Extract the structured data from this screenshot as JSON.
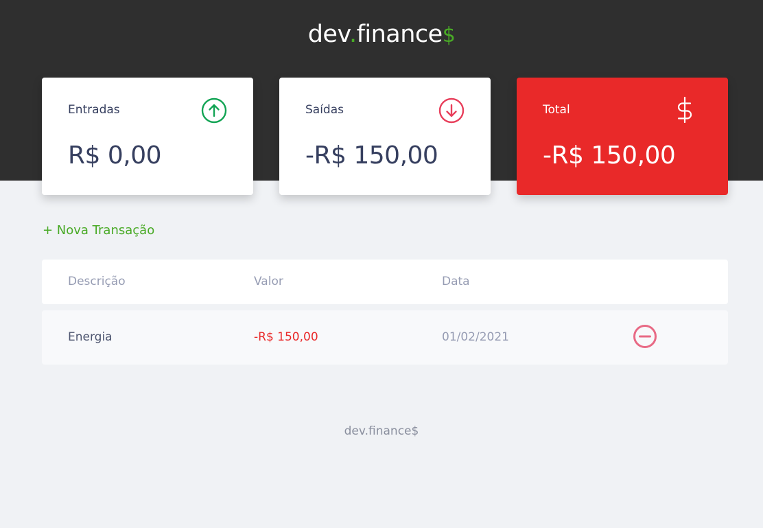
{
  "header": {
    "logo": {
      "main": "dev",
      "dot": ".",
      "rest": "finance",
      "dollar": "$"
    }
  },
  "summary": {
    "income": {
      "label": "Entradas",
      "value": "R$ 0,00",
      "icon": "arrow-up-circle-icon"
    },
    "expense": {
      "label": "Saídas",
      "value": "-R$ 150,00",
      "icon": "arrow-down-circle-icon"
    },
    "total": {
      "label": "Total",
      "value": "-R$ 150,00",
      "icon": "dollar-sign-icon"
    }
  },
  "actions": {
    "new_transaction": "+ Nova Transação"
  },
  "table": {
    "headers": [
      "Descrição",
      "Valor",
      "Data"
    ],
    "rows": [
      {
        "description": "Energia",
        "amount": "-R$ 150,00",
        "date": "01/02/2021"
      }
    ]
  },
  "footer": {
    "text": "dev.finance$"
  },
  "colors": {
    "header_bg": "#2f2f2f",
    "page_bg": "#f0f2f5",
    "brand_green": "#49aa26",
    "total_red": "#e92929",
    "text_dark": "#363f5f",
    "text_muted": "#969cb3"
  }
}
